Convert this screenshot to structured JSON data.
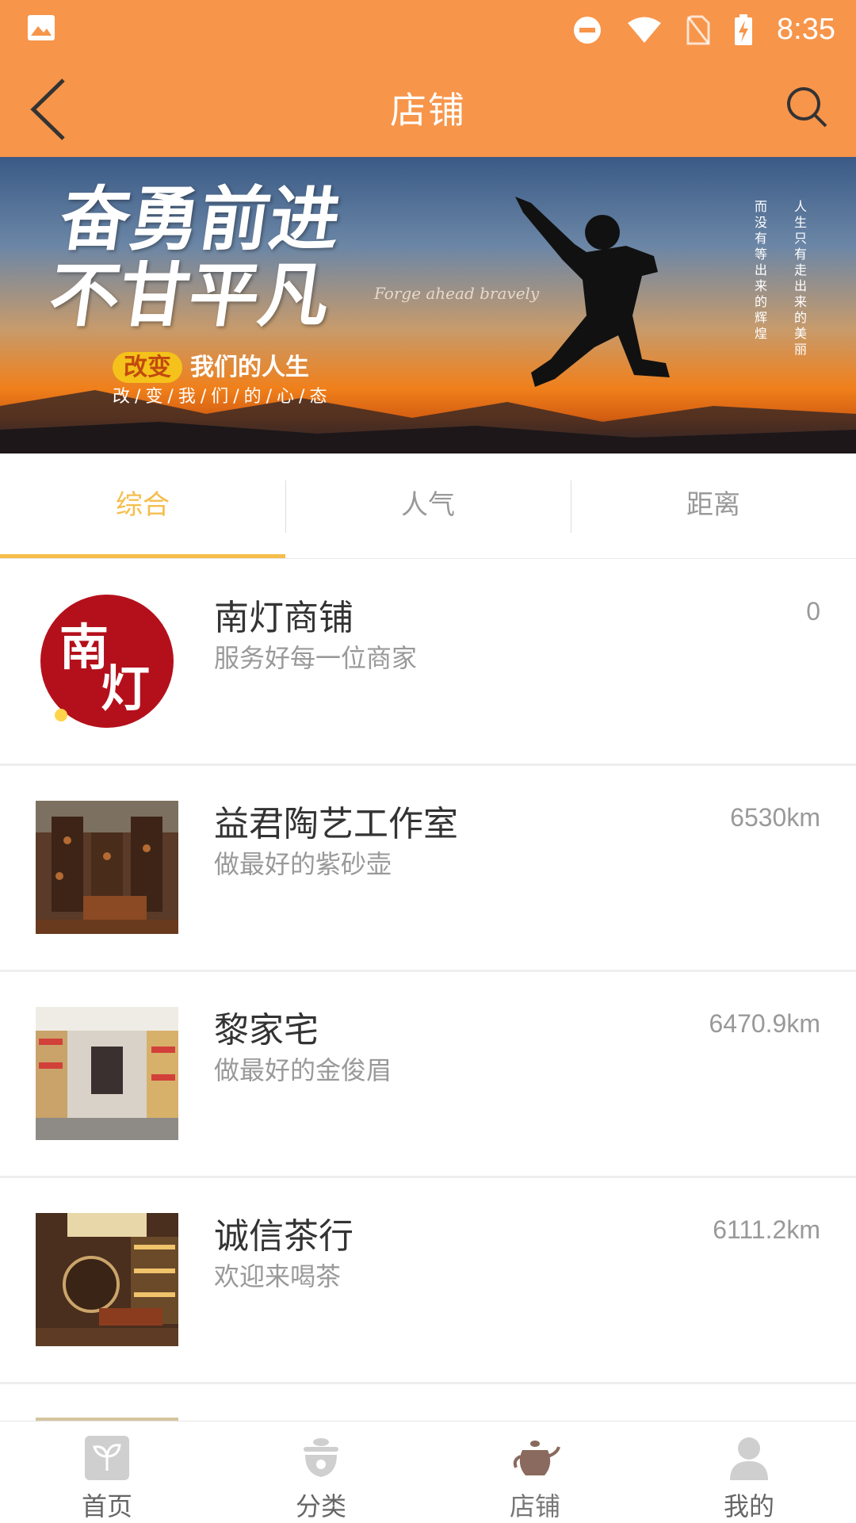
{
  "status_bar": {
    "time": "8:35"
  },
  "app_bar": {
    "title": "店铺"
  },
  "banner": {
    "headline_line1": "奋勇前进",
    "headline_line2": "不甘平凡",
    "english": "Forge ahead bravely",
    "slogan_highlight": "改变",
    "slogan_rest": "我们的人生",
    "subline": "改/变/我/们/的/心/态",
    "vertical_left": "而没有等出来的辉煌",
    "vertical_right": "人生只有走出来的美丽"
  },
  "tabs": [
    {
      "label": "综合",
      "active": true
    },
    {
      "label": "人气",
      "active": false
    },
    {
      "label": "距离",
      "active": false
    }
  ],
  "stores": [
    {
      "name": "南灯商铺",
      "desc": "服务好每一位商家",
      "distance": "0",
      "logo_text_1": "南",
      "logo_text_2": "灯"
    },
    {
      "name": "益君陶艺工作室",
      "desc": "做最好的紫砂壶",
      "distance": "6530km"
    },
    {
      "name": "黎家宅",
      "desc": "做最好的金俊眉",
      "distance": "6470.9km"
    },
    {
      "name": "诚信茶行",
      "desc": "欢迎来喝茶",
      "distance": "6111.2km"
    }
  ],
  "bottom_nav": [
    {
      "label": "首页",
      "icon": "home-leaf-icon"
    },
    {
      "label": "分类",
      "icon": "category-teacup-icon"
    },
    {
      "label": "店铺",
      "icon": "store-teapot-icon",
      "active": true
    },
    {
      "label": "我的",
      "icon": "profile-person-icon"
    }
  ],
  "colors": {
    "primary": "#F7954A",
    "tab_active": "#F5BE4C",
    "text_primary": "#333333",
    "text_secondary": "#999999"
  }
}
